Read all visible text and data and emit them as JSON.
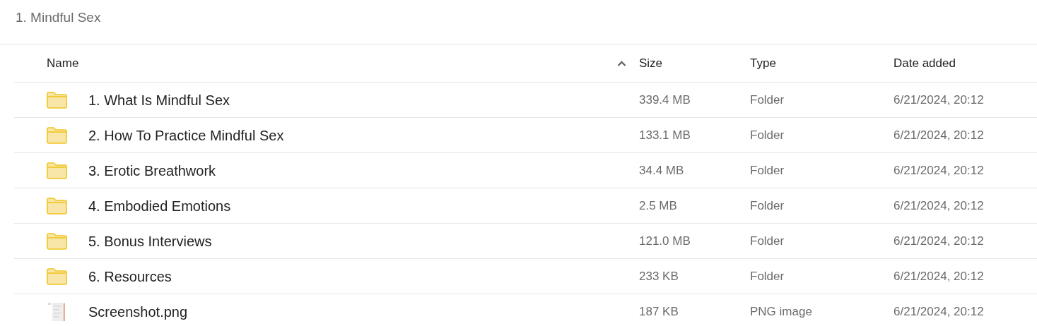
{
  "breadcrumb": "1. Mindful Sex",
  "table": {
    "columns": [
      {
        "label": "Name",
        "sorted": true
      },
      {
        "label": "Size"
      },
      {
        "label": "Type"
      },
      {
        "label": "Date added"
      }
    ],
    "rows": [
      {
        "kind": "folder",
        "name": "1. What Is Mindful Sex",
        "size": "339.4 MB",
        "type": "Folder",
        "date": "6/21/2024, 20:12"
      },
      {
        "kind": "folder",
        "name": "2. How To Practice Mindful Sex",
        "size": "133.1 MB",
        "type": "Folder",
        "date": "6/21/2024, 20:12"
      },
      {
        "kind": "folder",
        "name": "3. Erotic Breathwork",
        "size": "34.4 MB",
        "type": "Folder",
        "date": "6/21/2024, 20:12"
      },
      {
        "kind": "folder",
        "name": "4. Embodied Emotions",
        "size": "2.5 MB",
        "type": "Folder",
        "date": "6/21/2024, 20:12"
      },
      {
        "kind": "folder",
        "name": "5. Bonus Interviews",
        "size": "121.0 MB",
        "type": "Folder",
        "date": "6/21/2024, 20:12"
      },
      {
        "kind": "folder",
        "name": "6. Resources",
        "size": "233 KB",
        "type": "Folder",
        "date": "6/21/2024, 20:12"
      },
      {
        "kind": "image",
        "name": "Screenshot.png",
        "size": "187 KB",
        "type": "PNG image",
        "date": "6/21/2024, 20:12"
      }
    ]
  }
}
